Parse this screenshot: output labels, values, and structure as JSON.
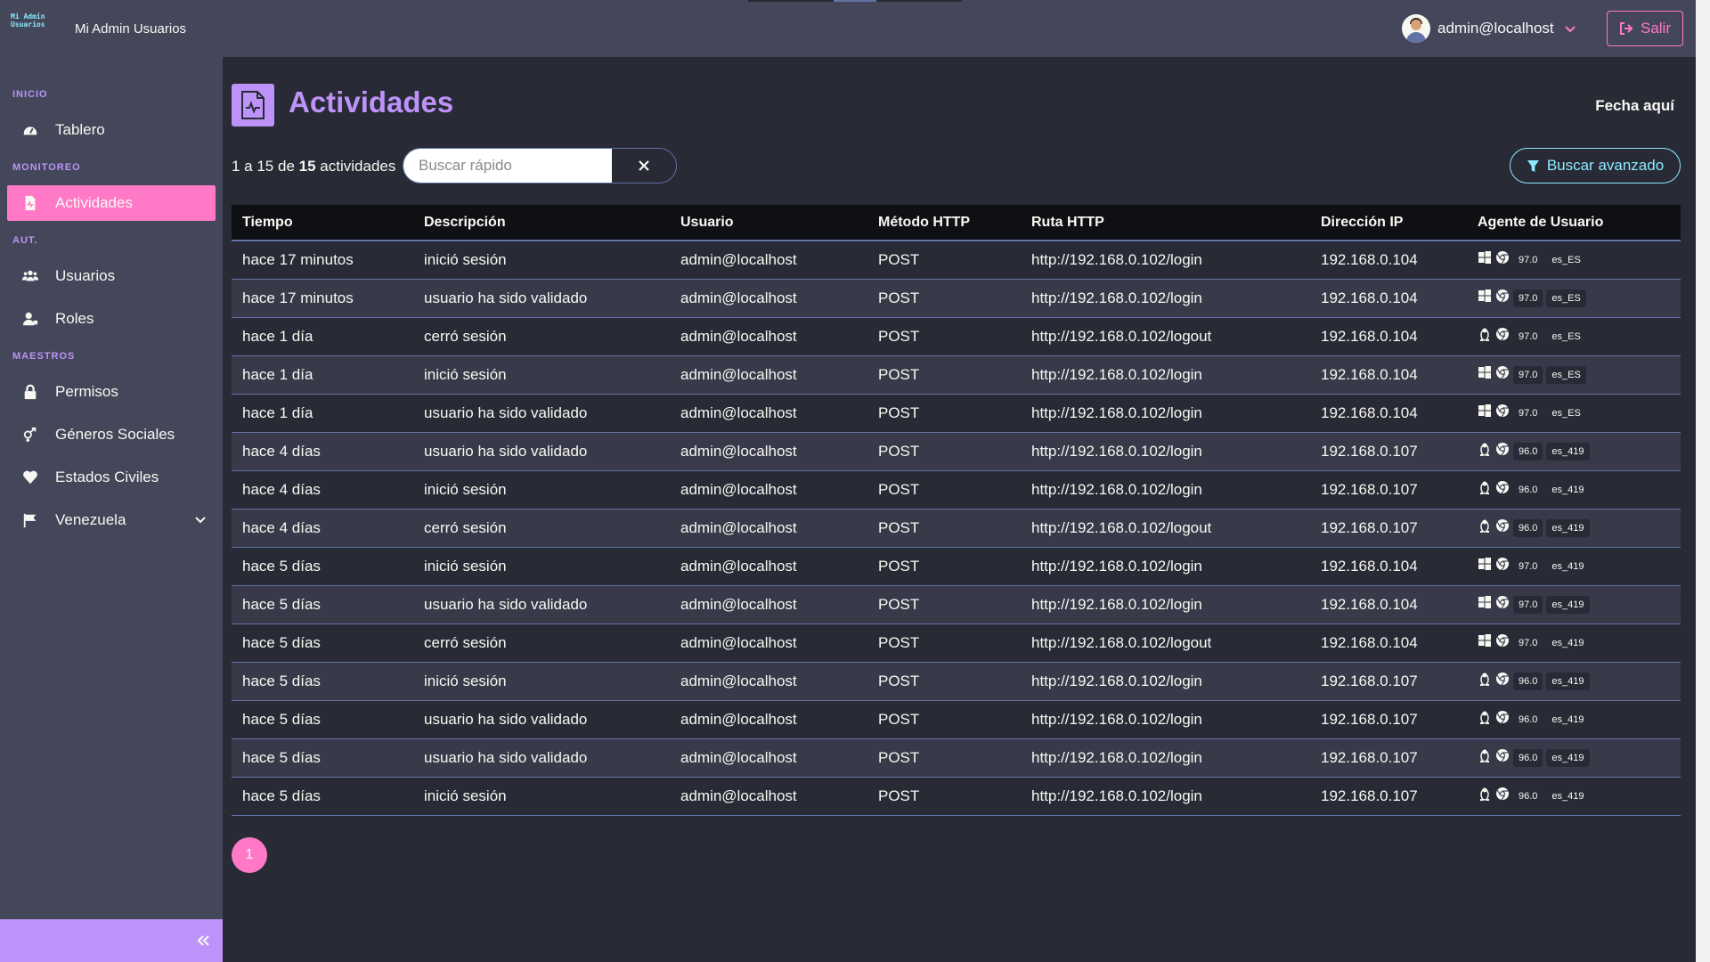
{
  "app": {
    "logo_text_line1": "Mi Admin",
    "logo_text_line2": "Usuarios",
    "title": "Mi Admin Usuarios"
  },
  "user_menu": {
    "email": "admin@localhost",
    "logout_label": "Salir"
  },
  "sidebar": {
    "sections": {
      "inicio": "INICIO",
      "monitoreo": "MONITOREO",
      "aut": "AUT.",
      "maestros": "MAESTROS"
    },
    "items": {
      "tablero": "Tablero",
      "actividades": "Actividades",
      "usuarios": "Usuarios",
      "roles": "Roles",
      "permisos": "Permisos",
      "generos": "Géneros Sociales",
      "estados": "Estados Civiles",
      "venezuela": "Venezuela"
    },
    "active_item": "Actividades"
  },
  "page": {
    "title": "Actividades",
    "date_placeholder": "Fecha aquí",
    "count_prefix": "1 a 15 de",
    "count_total": "15",
    "count_suffix": "actividades",
    "search_placeholder": "Buscar rápido",
    "advanced_search_label": "Buscar avanzado",
    "current_page": "1"
  },
  "table": {
    "columns": [
      "Tiempo",
      "Descripción",
      "Usuario",
      "Método HTTP",
      "Ruta HTTP",
      "Dirección IP",
      "Agente de Usuario"
    ],
    "rows": [
      {
        "tiempo": "hace 17 minutos",
        "descripcion": "inició sesión",
        "usuario": "admin@localhost",
        "metodo": "POST",
        "ruta": "http://192.168.0.102/login",
        "ip": "192.168.0.104",
        "os": "windows-icon",
        "version": "97.0",
        "locale": "es_ES"
      },
      {
        "tiempo": "hace 17 minutos",
        "descripcion": "usuario ha sido validado",
        "usuario": "admin@localhost",
        "metodo": "POST",
        "ruta": "http://192.168.0.102/login",
        "ip": "192.168.0.104",
        "os": "windows-icon",
        "version": "97.0",
        "locale": "es_ES"
      },
      {
        "tiempo": "hace 1 día",
        "descripcion": "cerró sesión",
        "usuario": "admin@localhost",
        "metodo": "POST",
        "ruta": "http://192.168.0.102/logout",
        "ip": "192.168.0.104",
        "os": "linux-icon",
        "version": "97.0",
        "locale": "es_ES"
      },
      {
        "tiempo": "hace 1 día",
        "descripcion": "inició sesión",
        "usuario": "admin@localhost",
        "metodo": "POST",
        "ruta": "http://192.168.0.102/login",
        "ip": "192.168.0.104",
        "os": "windows-icon",
        "version": "97.0",
        "locale": "es_ES"
      },
      {
        "tiempo": "hace 1 día",
        "descripcion": "usuario ha sido validado",
        "usuario": "admin@localhost",
        "metodo": "POST",
        "ruta": "http://192.168.0.102/login",
        "ip": "192.168.0.104",
        "os": "windows-icon",
        "version": "97.0",
        "locale": "es_ES"
      },
      {
        "tiempo": "hace 4 días",
        "descripcion": "usuario ha sido validado",
        "usuario": "admin@localhost",
        "metodo": "POST",
        "ruta": "http://192.168.0.102/login",
        "ip": "192.168.0.107",
        "os": "linux-icon",
        "version": "96.0",
        "locale": "es_419"
      },
      {
        "tiempo": "hace 4 días",
        "descripcion": "inició sesión",
        "usuario": "admin@localhost",
        "metodo": "POST",
        "ruta": "http://192.168.0.102/login",
        "ip": "192.168.0.107",
        "os": "linux-icon",
        "version": "96.0",
        "locale": "es_419"
      },
      {
        "tiempo": "hace 4 días",
        "descripcion": "cerró sesión",
        "usuario": "admin@localhost",
        "metodo": "POST",
        "ruta": "http://192.168.0.102/logout",
        "ip": "192.168.0.107",
        "os": "linux-icon",
        "version": "96.0",
        "locale": "es_419"
      },
      {
        "tiempo": "hace 5 días",
        "descripcion": "inició sesión",
        "usuario": "admin@localhost",
        "metodo": "POST",
        "ruta": "http://192.168.0.102/login",
        "ip": "192.168.0.104",
        "os": "windows-icon",
        "version": "97.0",
        "locale": "es_419"
      },
      {
        "tiempo": "hace 5 días",
        "descripcion": "usuario ha sido validado",
        "usuario": "admin@localhost",
        "metodo": "POST",
        "ruta": "http://192.168.0.102/login",
        "ip": "192.168.0.104",
        "os": "windows-icon",
        "version": "97.0",
        "locale": "es_419"
      },
      {
        "tiempo": "hace 5 días",
        "descripcion": "cerró sesión",
        "usuario": "admin@localhost",
        "metodo": "POST",
        "ruta": "http://192.168.0.102/logout",
        "ip": "192.168.0.104",
        "os": "windows-icon",
        "version": "97.0",
        "locale": "es_419"
      },
      {
        "tiempo": "hace 5 días",
        "descripcion": "inició sesión",
        "usuario": "admin@localhost",
        "metodo": "POST",
        "ruta": "http://192.168.0.102/login",
        "ip": "192.168.0.107",
        "os": "linux-icon",
        "version": "96.0",
        "locale": "es_419"
      },
      {
        "tiempo": "hace 5 días",
        "descripcion": "usuario ha sido validado",
        "usuario": "admin@localhost",
        "metodo": "POST",
        "ruta": "http://192.168.0.102/login",
        "ip": "192.168.0.107",
        "os": "linux-icon",
        "version": "96.0",
        "locale": "es_419"
      },
      {
        "tiempo": "hace 5 días",
        "descripcion": "usuario ha sido validado",
        "usuario": "admin@localhost",
        "metodo": "POST",
        "ruta": "http://192.168.0.102/login",
        "ip": "192.168.0.107",
        "os": "linux-icon",
        "version": "96.0",
        "locale": "es_419"
      },
      {
        "tiempo": "hace 5 días",
        "descripcion": "inició sesión",
        "usuario": "admin@localhost",
        "metodo": "POST",
        "ruta": "http://192.168.0.102/login",
        "ip": "192.168.0.107",
        "os": "linux-icon",
        "version": "96.0",
        "locale": "es_419"
      }
    ]
  },
  "colors": {
    "background": "#282a36",
    "panel": "#44475a",
    "accent_purple": "#bd93f9",
    "accent_pink": "#ff79c6",
    "accent_cyan": "#8be9fd",
    "border": "#6272a4"
  }
}
